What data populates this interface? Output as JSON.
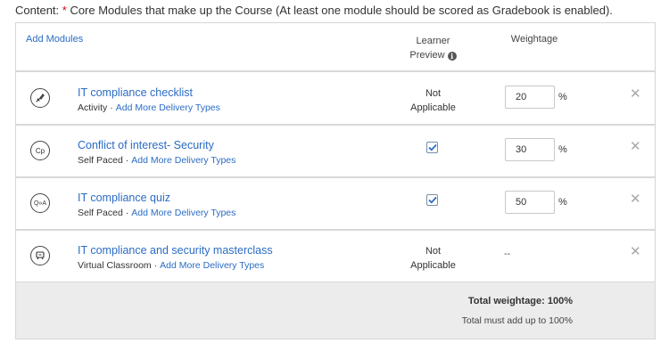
{
  "caption": {
    "prefix": "Content: ",
    "required_mark": "*",
    "text": " Core Modules that make up the Course (At least one module should be scored as Gradebook is enabled)."
  },
  "header": {
    "add_modules": "Add Modules",
    "learner_preview_line1": "Learner",
    "learner_preview_line2": "Preview",
    "info_glyph": "i",
    "weightage": "Weightage"
  },
  "modules": [
    {
      "icon": "checklist-icon",
      "title": "IT compliance checklist",
      "type": "Activity",
      "delivery_link": "Add More Delivery Types",
      "preview": "Not Applicable",
      "preview_line1": "Not",
      "preview_line2": "Applicable",
      "weight": "20",
      "unit": "%",
      "remove": "✕"
    },
    {
      "icon": "cp-icon",
      "icon_text": "Cp",
      "title": "Conflict of interest- Security",
      "type": "Self Paced",
      "delivery_link": "Add More Delivery Types",
      "preview_checked": true,
      "weight": "30",
      "unit": "%",
      "remove": "✕"
    },
    {
      "icon": "qna-icon",
      "icon_text": "Q»A",
      "title": "IT compliance quiz",
      "type": "Self Paced",
      "delivery_link": "Add More Delivery Types",
      "preview_checked": true,
      "weight": "50",
      "unit": "%",
      "remove": "✕"
    },
    {
      "icon": "classroom-icon",
      "title": "IT compliance and security masterclass",
      "type": "Virtual Classroom",
      "delivery_link": "Add More Delivery Types",
      "preview_line1": "Not",
      "preview_line2": "Applicable",
      "weight": "--",
      "remove": "✕"
    }
  ],
  "footer": {
    "total_label": "Total weightage: 100%",
    "note": "Total must add up to 100%"
  },
  "separator": "·"
}
